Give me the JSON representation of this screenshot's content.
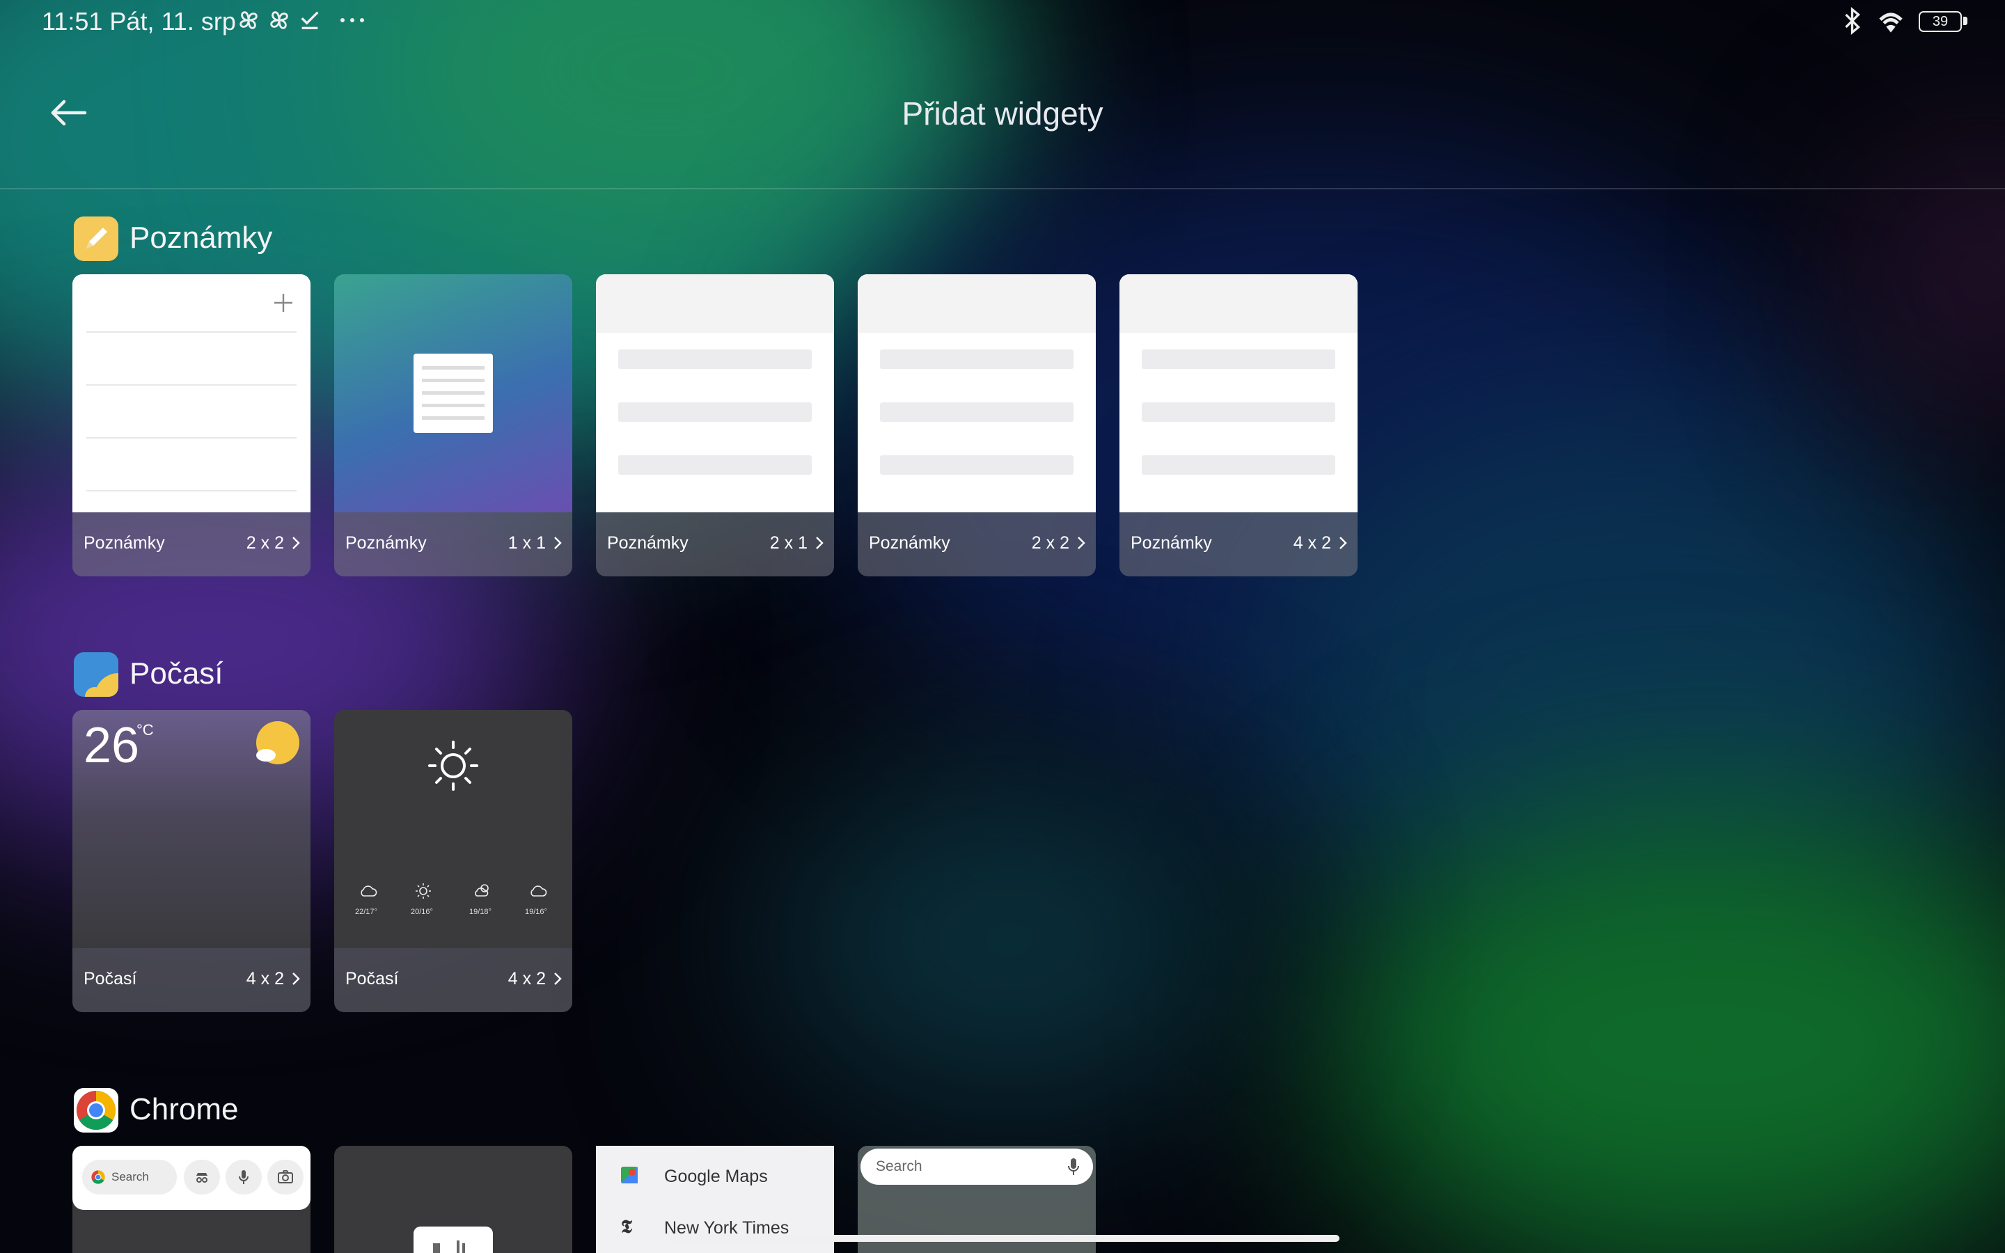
{
  "status_bar": {
    "time": "11:51 Pát, 11. srp",
    "battery": "39",
    "icons": [
      "pinwheel-icon",
      "pinwheel-icon",
      "checklist-icon",
      "more-dots-icon",
      "bluetooth-icon",
      "wifi-icon",
      "battery-icon"
    ]
  },
  "header": {
    "title": "Přidat widgety",
    "back_icon": "arrow-left-icon"
  },
  "sections": [
    {
      "title": "Poznámky",
      "icon": "notes-pencil-icon",
      "widgets": [
        {
          "name": "Poznámky",
          "size": "2 x 2"
        },
        {
          "name": "Poznámky",
          "size": "1 x 1"
        },
        {
          "name": "Poznámky",
          "size": "2 x 1"
        },
        {
          "name": "Poznámky",
          "size": "2 x 2"
        },
        {
          "name": "Poznámky",
          "size": "4 x 2"
        }
      ]
    },
    {
      "title": "Počasí",
      "icon": "weather-icon",
      "widgets": [
        {
          "name": "Počasí",
          "size": "4 x 2",
          "temp": "26",
          "unit": "°C"
        },
        {
          "name": "Počasí",
          "size": "4 x 2",
          "forecast": [
            "22/17°",
            "20/16°",
            "19/18°",
            "19/16°"
          ]
        }
      ]
    },
    {
      "title": "Chrome",
      "icon": "chrome-icon",
      "widgets": [
        {
          "search_label": "Search"
        },
        {},
        {
          "bookmarks": [
            "Google Maps",
            "New York Times"
          ]
        },
        {
          "search_label": "Search"
        }
      ]
    }
  ],
  "colors": {
    "card_footer": "#6b6b73",
    "weather_card": "#3a3a3d",
    "sun_yellow": "#f5c542"
  }
}
